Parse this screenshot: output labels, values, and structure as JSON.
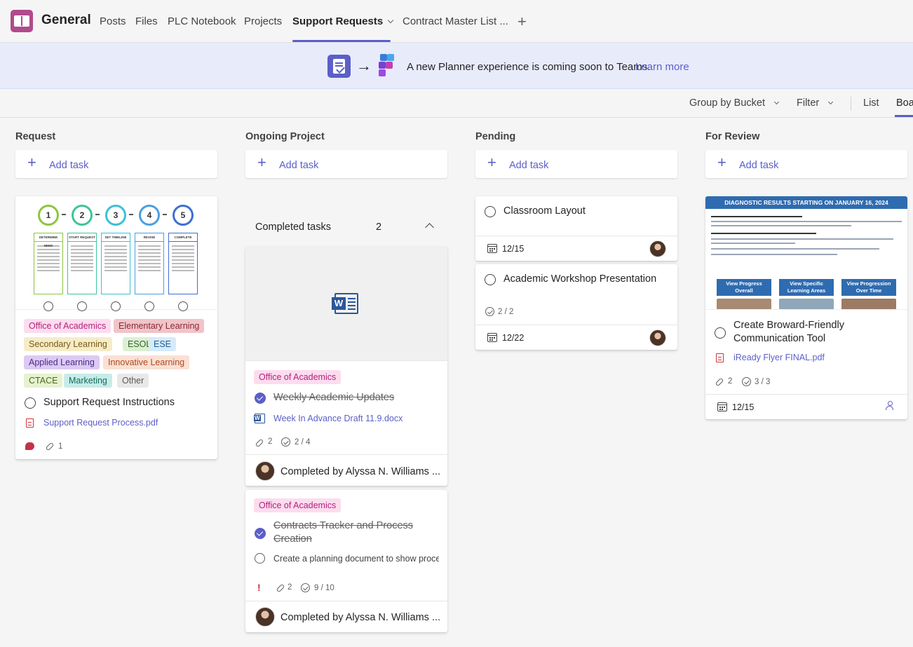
{
  "header": {
    "team_name": "General",
    "tabs": [
      "Posts",
      "Files",
      "PLC Notebook",
      "Projects",
      "Support Requests",
      "Contract Master List ..."
    ],
    "active_tab": "Support Requests"
  },
  "banner": {
    "text": "A new Planner experience is coming soon to Teams.",
    "link": "Learn more"
  },
  "toolbar": {
    "group_by": "Group by Bucket",
    "filter": "Filter",
    "views": [
      "List",
      "Boa"
    ]
  },
  "colors": {
    "accent": "#5b5fc7",
    "banner_bg": "#e8ebfa",
    "team_icon": "#b14a8c"
  },
  "columns": [
    {
      "title": "Request",
      "add_task": "Add task",
      "cards": [
        {
          "preview": "flowchart-image",
          "preview_text": {
            "steps": [
              "1",
              "2",
              "3",
              "4",
              "5"
            ],
            "headers": [
              "DETERMINE NEED",
              "START REQUEST",
              "SET TIMELINE",
              "REVISE",
              "COMPLETE"
            ]
          },
          "labels": [
            "Office of Academics",
            "Elementary Learning",
            "Secondary Learning",
            "ESOL",
            "ESE",
            "Applied Learning",
            "Innovative Learning",
            "CTACE",
            "Marketing",
            "Other"
          ],
          "title": "Support Request Instructions",
          "attachment": "Support Request Process.pdf",
          "attachments_count": "1"
        }
      ]
    },
    {
      "title": "Ongoing Project",
      "add_task": "Add task",
      "completed_header": {
        "label": "Completed tasks",
        "count": "2"
      },
      "cards": [
        {
          "preview": "word-document",
          "label": "Office of Academics",
          "title": "Weekly Academic Updates",
          "attachment": "Week In Advance Draft 11.9.docx",
          "attachments_count": "2",
          "checklist": "2 / 4",
          "completed_by": "Completed by Alyssa N. Williams ..."
        },
        {
          "label": "Office of Academics",
          "title": "Contracts Tracker and Process Creation",
          "checklist_item": "Create a planning document to show process",
          "priority": "!",
          "attachments_count": "2",
          "checklist": "9 / 10",
          "completed_by": "Completed by Alyssa N. Williams ..."
        }
      ]
    },
    {
      "title": "Pending",
      "add_task": "Add task",
      "cards": [
        {
          "title": "Classroom Layout",
          "due": "12/15"
        },
        {
          "title": "Academic Workshop Presentation",
          "checklist": "2 / 2",
          "due": "12/22"
        }
      ]
    },
    {
      "title": "For Review",
      "add_task": "Add task",
      "cards": [
        {
          "preview": "diagnostic-flyer",
          "preview_text": {
            "heading": "DIAGNOSTIC RESULTS STARTING ON JANUARY 16, 2024",
            "buttons": [
              "View Progress Overall",
              "View Specific Learning Areas",
              "View Progression Over Time"
            ]
          },
          "title": "Create Broward-Friendly Communication Tool",
          "attachment": "iReady Flyer FINAL.pdf",
          "attachments_count": "2",
          "checklist": "3 / 3",
          "due": "12/15"
        }
      ]
    }
  ]
}
